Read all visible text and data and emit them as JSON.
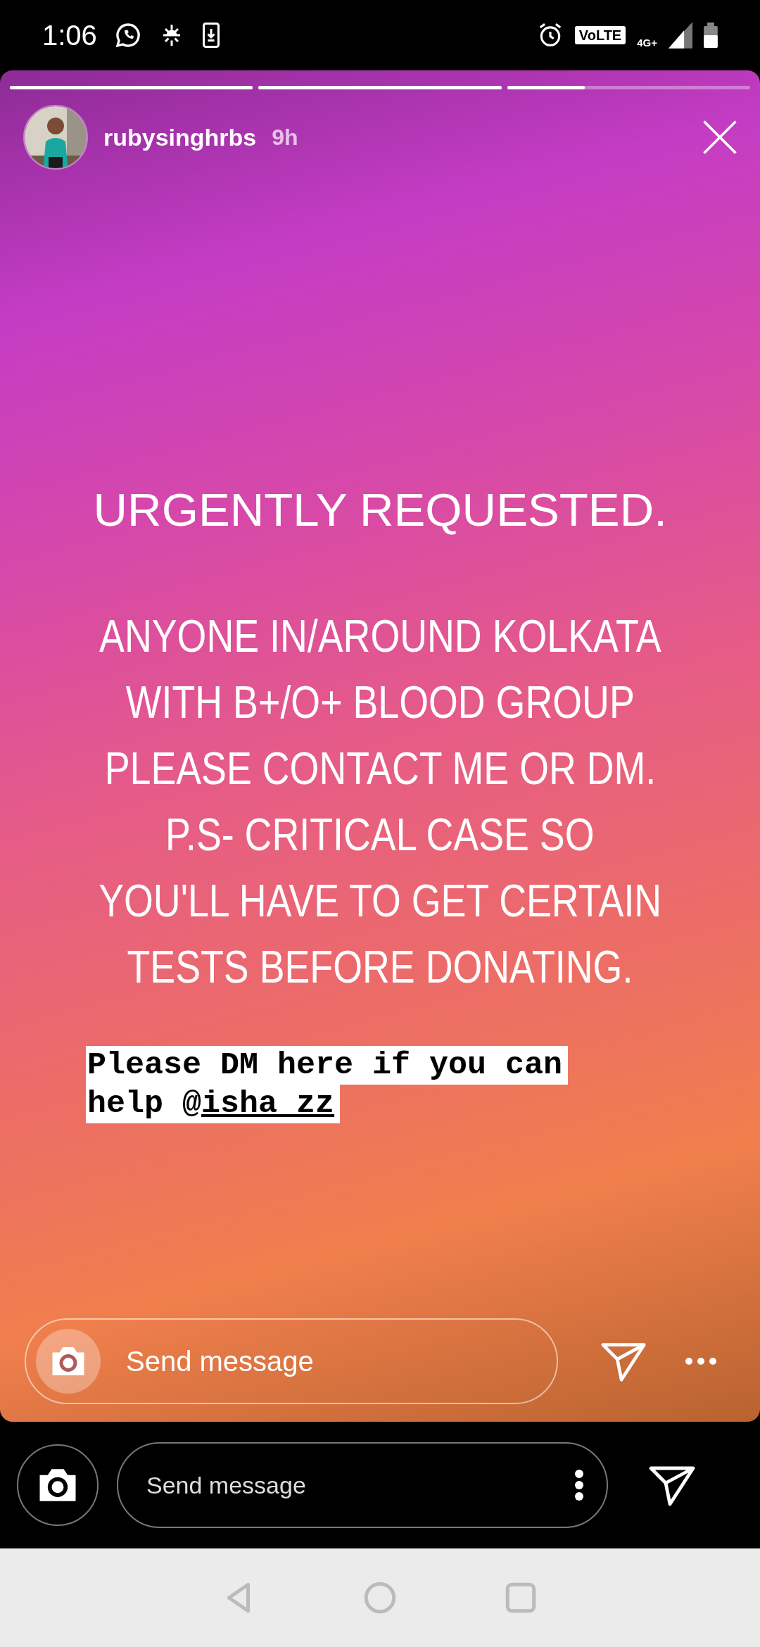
{
  "status_bar": {
    "time": "1:06",
    "volte": "VoLTE",
    "network": "4G+"
  },
  "story": {
    "progress": [
      {
        "level": 1
      },
      {
        "level": 1
      },
      {
        "level": 0.32
      }
    ],
    "username": "rubysinghrbs",
    "age": "9h",
    "headline": "URGENTLY REQUESTED.",
    "lines": [
      "ANYONE IN/AROUND KOLKATA",
      "WITH B+/O+ BLOOD GROUP",
      "PLEASE CONTACT ME OR DM.",
      "P.S- CRITICAL CASE SO",
      "YOU'LL HAVE TO GET CERTAIN",
      "TESTS BEFORE DONATING."
    ],
    "sticker": [
      {
        "text": "Please DM here if you can"
      },
      {
        "text": "help @",
        "mention": "isha_zz"
      }
    ],
    "reply": {
      "placeholder": "Send message"
    }
  },
  "reply_bar": {
    "placeholder": "Send message"
  }
}
